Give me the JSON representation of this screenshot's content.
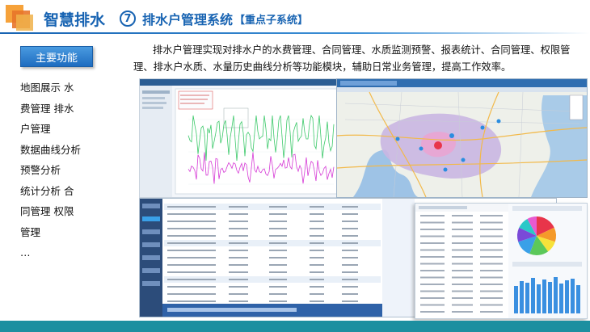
{
  "header": {
    "title": "智慧排水",
    "number": "⑦",
    "subtitle": "排水户管理系统",
    "tag": "【重点子系统】"
  },
  "sidebar": {
    "button_label": "主要功能",
    "lines": [
      "地图展示 水",
      "费管理 排水",
      "户管理",
      "数据曲线分析",
      "预警分析",
      "统计分析 合",
      "同管理 权限",
      "管理",
      "…"
    ]
  },
  "description": "排水户管理实现对排水户的水费管理、合同管理、水质监测预警、报表统计、合同管理、权限管理、排水户水质、水量历史曲线分析等功能模块，辅助日常业务管理，提高工作效率。",
  "colors": {
    "brand_blue": "#1763b2",
    "button_blue": "#2a7bd0",
    "footer_teal": "#1c8fa0",
    "series_green": "#3cc96a",
    "series_magenta": "#d63ad6",
    "pie": [
      "#e8354a",
      "#f59a2a",
      "#f7e23a",
      "#5cc85a",
      "#3aa0e8",
      "#7a4ad8",
      "#2ac8c8",
      "#e85ad0"
    ]
  },
  "screens": {
    "line_chart": "water-quality-history-screenshot",
    "map": "district-map-screenshot",
    "table": "customer-table-screenshot",
    "stats": "statistics-panel-screenshot"
  }
}
